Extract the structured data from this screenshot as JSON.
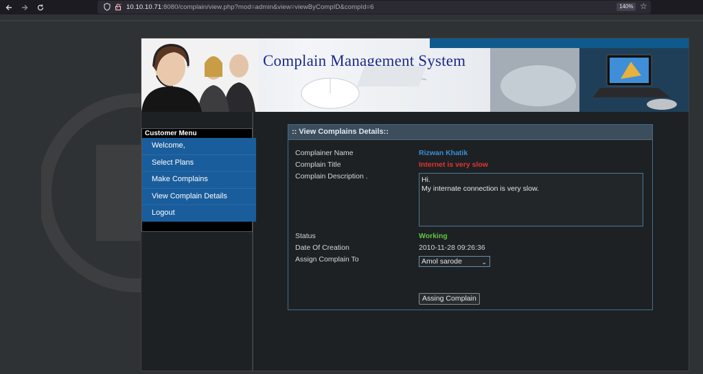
{
  "browser": {
    "url_host": "10.10.10.71",
    "url_rest": ":8080/complain/view.php?mod=admin&view=viewByCompID&compId=6",
    "zoom": "140%"
  },
  "banner": {
    "title": "Complain Management System"
  },
  "sidebar": {
    "header": "Customer Menu",
    "items": [
      {
        "label": "Welcome,"
      },
      {
        "label": "Select Plans"
      },
      {
        "label": "Make Complains"
      },
      {
        "label": "View Complain Details"
      },
      {
        "label": "Logout"
      }
    ]
  },
  "panel": {
    "header": ":: View Complains Details::",
    "fields": {
      "complainer_label": "Complainer Name",
      "complainer_value": "Rizwan Khatik",
      "title_label": "Complain Title",
      "title_value": "Internet is very slow",
      "desc_label": "Complain Description .",
      "desc_line1": "Hi.",
      "desc_line2": "My internate connection is very slow.",
      "status_label": "Status",
      "status_value": "Working",
      "date_label": "Date Of Creation",
      "date_value": "2010-11-28 09:26:36",
      "assign_label": "Assign Complain To",
      "assign_value": "Amol sarode"
    },
    "button_label": "Assing Complain"
  },
  "colors": {
    "menu_blue": "#1a5d9c",
    "name_blue": "#3b8fd6",
    "title_red": "#e53333",
    "status_green": "#5ec93f",
    "banner_title": "#1a2a8a"
  },
  "icons": {
    "back": "back-arrow-icon",
    "forward": "forward-arrow-icon",
    "reload": "reload-icon",
    "shield": "shield-icon",
    "insecure": "insecure-lock-icon",
    "bookmark": "star-icon"
  }
}
